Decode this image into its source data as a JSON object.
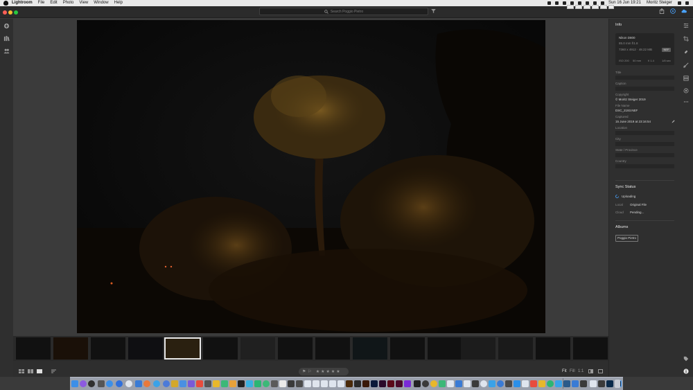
{
  "menubar": {
    "app_name": "Lightroom",
    "items": [
      "File",
      "Edit",
      "Photo",
      "View",
      "Window",
      "Help"
    ],
    "clock": "Sun 16 Jun  19:21",
    "user": "Moritz Steiger"
  },
  "toolbar": {
    "search_placeholder": "Search Poggio Pietro"
  },
  "info_panel": {
    "title": "Info",
    "camera_model": "Nikon D800",
    "lens": "85.0 mm f/1.8",
    "dimensions_size": "7360 x 4912  ·  48.22 MB",
    "file_type": "NEF",
    "iso": "ISO 200",
    "focal_length": "50 mm",
    "aperture": "f/ 1.4",
    "shutter": "1/8 sec",
    "title_label": "Title",
    "caption_label": "Caption",
    "copyright_label": "Copyright",
    "copyright_value": "© Moritz Steiger 2019",
    "filename_label": "File Name",
    "filename_value": "DSC_2193.NEF",
    "captured_label": "Captured",
    "captured_value": "15 June 2019 at 23:16:54",
    "location_label": "Location",
    "city_label": "City",
    "state_label": "State / Province",
    "country_label": "Country"
  },
  "sync": {
    "title": "Sync Status",
    "status": "Uploading",
    "local_label": "Local",
    "local_value": "Original File",
    "cloud_label": "Cloud",
    "cloud_value": "Pending..."
  },
  "albums": {
    "title": "Albums",
    "album": "Poggio Pietro"
  },
  "bottom": {
    "rating_stars": "★★★★★",
    "zoom_fit": "Fit",
    "zoom_fill": "Fill",
    "zoom_1to1": "1:1"
  },
  "colors": {
    "traffic_close": "#ff5f57",
    "traffic_min": "#febc2e",
    "traffic_max": "#28c840",
    "accent_blue": "#4aa3ff"
  }
}
